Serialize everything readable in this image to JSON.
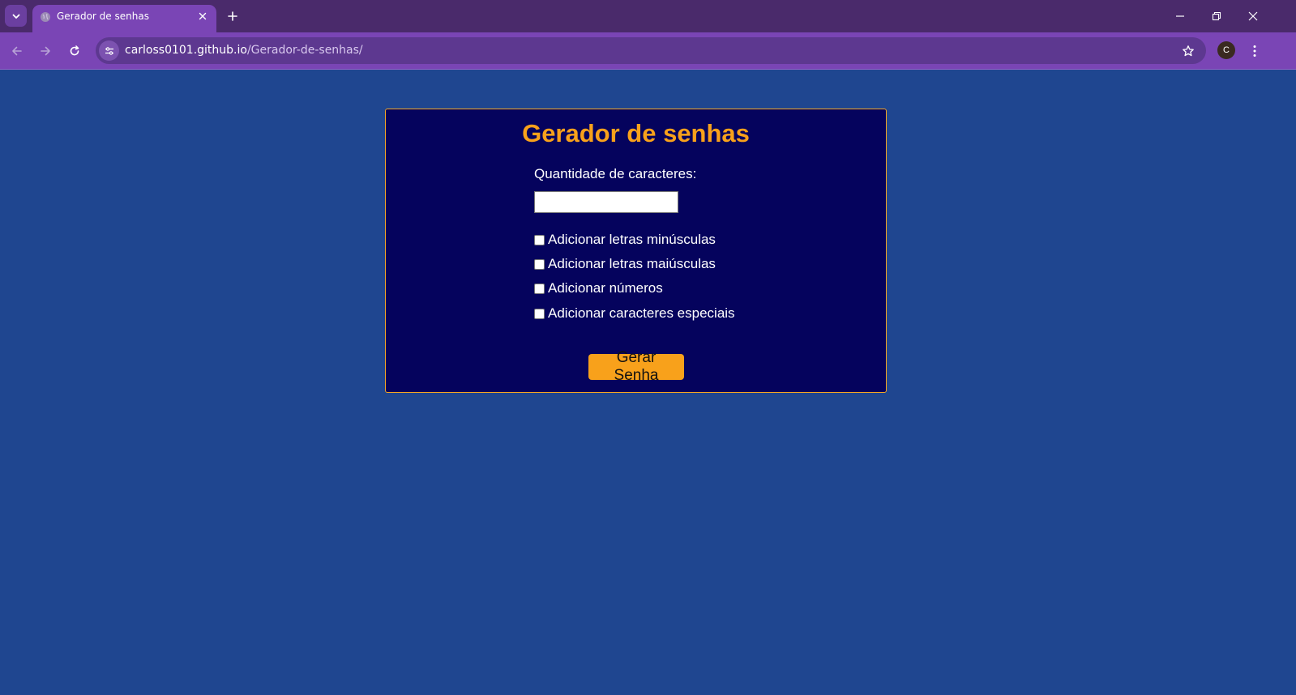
{
  "browser": {
    "tab": {
      "title": "Gerador de senhas"
    },
    "address_bar": {
      "host": "carloss0101.github.io",
      "path": "/Gerador-de-senhas/"
    },
    "profile_initial": "C"
  },
  "page": {
    "title": "Gerador de senhas",
    "quantity_label": "Quantidade de caracteres:",
    "quantity_value": "",
    "options": [
      {
        "label": "Adicionar letras minúsculas",
        "checked": false
      },
      {
        "label": "Adicionar letras maiúsculas",
        "checked": false
      },
      {
        "label": "Adicionar números",
        "checked": false
      },
      {
        "label": "Adicionar caracteres especiais",
        "checked": false
      }
    ],
    "generate_button": "Gerar Senha"
  },
  "colors": {
    "page_background": "#1f4690",
    "card_background": "#05035d",
    "accent": "#f8a11b",
    "browser_frame": "#4a2a6b",
    "toolbar": "#7a45b5"
  },
  "icons": {
    "tab_search": "chevron-down-icon",
    "favicon": "globe-icon",
    "tab_close": "close-icon",
    "new_tab": "plus-icon",
    "back": "arrow-left-icon",
    "forward": "arrow-right-icon",
    "reload": "reload-icon",
    "site_info": "tune-icon",
    "bookmark": "star-icon",
    "menu": "more-vertical-icon",
    "minimize": "minimize-icon",
    "restore": "restore-icon",
    "close": "close-window-icon"
  }
}
